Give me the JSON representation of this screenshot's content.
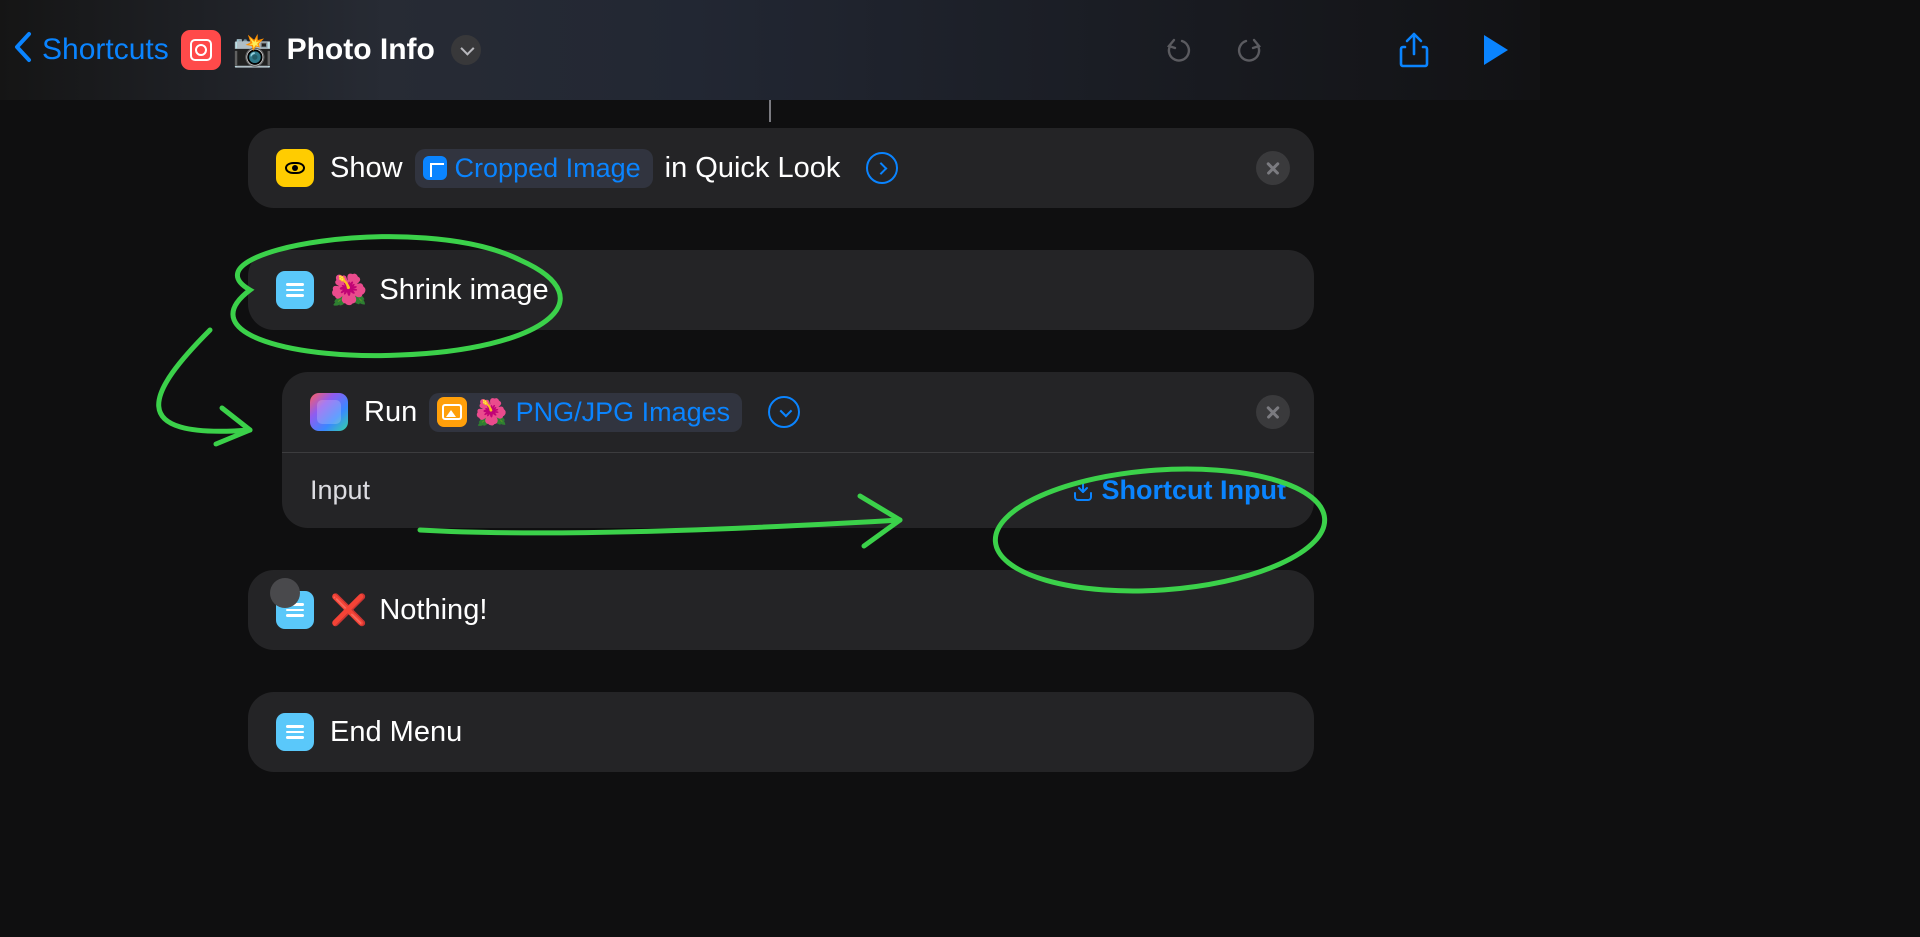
{
  "toolbar": {
    "back_label": "Shortcuts",
    "title": "Photo Info",
    "camera_emoji": "📸"
  },
  "actions": {
    "show_quicklook": {
      "verb": "Show",
      "variable": "Cropped Image",
      "suffix": "in Quick Look"
    },
    "menu_item_shrink": {
      "emoji": "🌺",
      "label": "Shrink image"
    },
    "run_shortcut": {
      "verb": "Run",
      "emoji": "🌺",
      "target": "PNG/JPG Images",
      "param_label": "Input",
      "param_value": "Shortcut Input"
    },
    "menu_item_nothing": {
      "emoji": "❌",
      "label": "Nothing!"
    },
    "end_menu": {
      "label": "End Menu"
    }
  }
}
